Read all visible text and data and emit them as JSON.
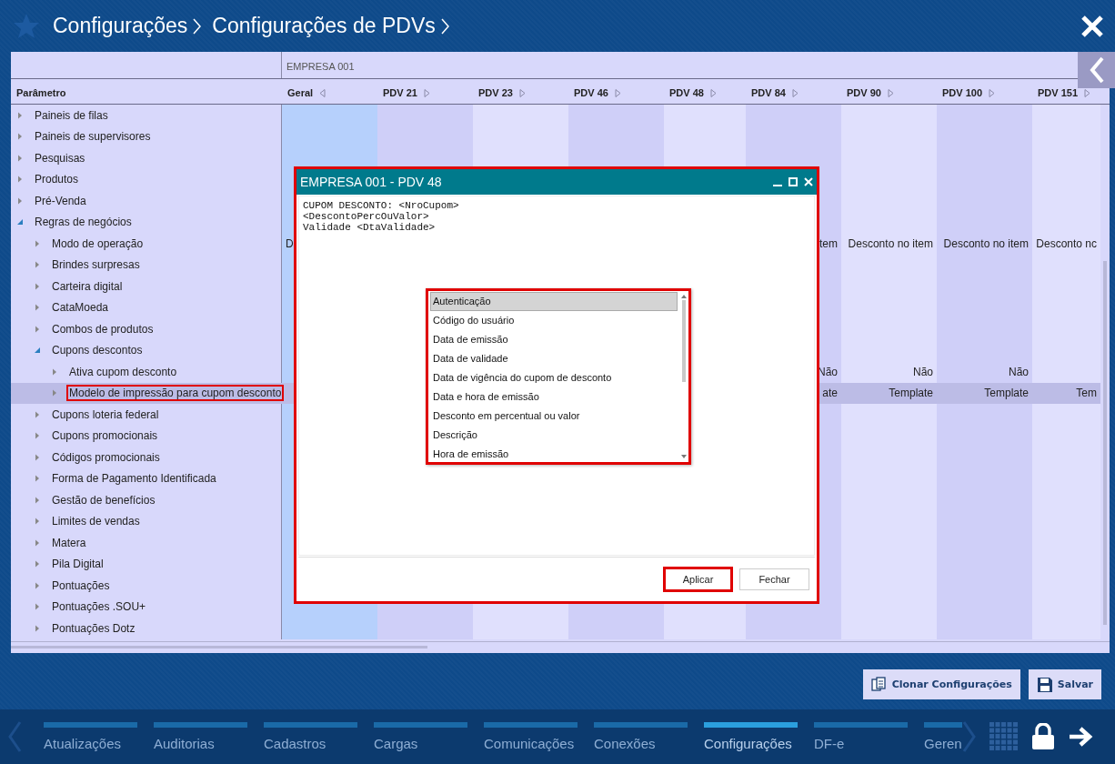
{
  "header": {
    "breadcrumb": [
      "Configurações",
      "Configurações de PDVs"
    ]
  },
  "grid": {
    "group_label": "EMPRESA 001",
    "parameter_header": "Parâmetro",
    "columns": [
      {
        "label": "Geral",
        "expanded": true,
        "selected": true
      },
      {
        "label": "PDV 21",
        "expanded": false,
        "selected": false
      },
      {
        "label": "PDV 23",
        "expanded": false,
        "selected": false
      },
      {
        "label": "PDV 46",
        "expanded": false,
        "selected": false
      },
      {
        "label": "PDV 48",
        "expanded": false,
        "selected": false
      },
      {
        "label": "PDV 84",
        "expanded": false,
        "selected": false
      },
      {
        "label": "PDV 90",
        "expanded": false,
        "selected": false
      },
      {
        "label": "PDV 100",
        "expanded": false,
        "selected": false
      },
      {
        "label": "PDV 151",
        "expanded": false,
        "selected": false
      }
    ],
    "tree": [
      {
        "label": "Paineis de filas",
        "expanded": false,
        "selected": false
      },
      {
        "label": "Paineis de supervisores",
        "expanded": false,
        "selected": false
      },
      {
        "label": "Pesquisas",
        "expanded": false,
        "selected": false
      },
      {
        "label": "Produtos",
        "expanded": false,
        "selected": false
      },
      {
        "label": "Pré-Venda",
        "expanded": false,
        "selected": false
      },
      {
        "label": "Regras de negócios",
        "expanded": true,
        "selected": false,
        "children": [
          {
            "label": "Modo de operação",
            "expanded": false,
            "selected": false,
            "cells": [
              "D",
              null,
              null,
              null,
              null,
              "tem",
              "Desconto no item",
              "Desconto no item",
              "Desconto nc"
            ]
          },
          {
            "label": "Brindes surpresas",
            "expanded": false,
            "selected": false
          },
          {
            "label": "Carteira digital",
            "expanded": false,
            "selected": false
          },
          {
            "label": "CataMoeda",
            "expanded": false,
            "selected": false
          },
          {
            "label": "Combos de produtos",
            "expanded": false,
            "selected": false
          },
          {
            "label": "Cupons descontos",
            "expanded": true,
            "selected": false,
            "children": [
              {
                "label": "Ativa cupom desconto",
                "expanded": false,
                "selected": false,
                "cells": [
                  null,
                  null,
                  null,
                  null,
                  null,
                  "Não",
                  "Não",
                  "Não",
                  null
                ]
              },
              {
                "label": "Modelo de impressão para cupom desconto",
                "expanded": false,
                "selected": true,
                "annotated": true,
                "cells": [
                  null,
                  null,
                  null,
                  null,
                  null,
                  "ate",
                  "Template",
                  "Template",
                  "Tem"
                ]
              }
            ]
          },
          {
            "label": "Cupons loteria federal",
            "expanded": false,
            "selected": false
          },
          {
            "label": "Cupons promocionais",
            "expanded": false,
            "selected": false
          },
          {
            "label": "Códigos promocionais",
            "expanded": false,
            "selected": false
          },
          {
            "label": "Forma de Pagamento Identificada",
            "expanded": false,
            "selected": false
          },
          {
            "label": "Gestão de benefícios",
            "expanded": false,
            "selected": false
          },
          {
            "label": "Limites de vendas",
            "expanded": false,
            "selected": false
          },
          {
            "label": "Matera",
            "expanded": false,
            "selected": false
          },
          {
            "label": "Pila Digital",
            "expanded": false,
            "selected": false
          },
          {
            "label": "Pontuações",
            "expanded": false,
            "selected": false
          },
          {
            "label": "Pontuações .SOU+",
            "expanded": false,
            "selected": false
          },
          {
            "label": "Pontuações Dotz",
            "expanded": false,
            "selected": false
          }
        ]
      }
    ]
  },
  "dialog": {
    "title": "EMPRESA 001 - PDV 48",
    "annotated": true,
    "value": "CUPOM DESCONTO: <NroCupom>\n<DescontoPercOuValor>\nValidade <DtaValidade>",
    "field_list": {
      "annotated": true,
      "items": [
        {
          "label": "Autenticação",
          "selected": true
        },
        {
          "label": "Código do usuário",
          "selected": false
        },
        {
          "label": "Data de emissão",
          "selected": false
        },
        {
          "label": "Data de validade",
          "selected": false
        },
        {
          "label": "Data de vigência do cupom de desconto",
          "selected": false
        },
        {
          "label": "Data e hora de emissão",
          "selected": false
        },
        {
          "label": "Desconto em percentual ou valor",
          "selected": false
        },
        {
          "label": "Descrição",
          "selected": false
        },
        {
          "label": "Hora de emissão",
          "selected": false
        }
      ]
    },
    "buttons": [
      {
        "label": "Aplicar",
        "annotated": true
      },
      {
        "label": "Fechar",
        "annotated": false
      }
    ]
  },
  "actions": [
    {
      "label": "Clonar Configurações",
      "kind": "clone"
    },
    {
      "label": "Salvar",
      "kind": "save"
    }
  ],
  "nav": [
    {
      "label": "Atualizações",
      "selected": false
    },
    {
      "label": "Auditorias",
      "selected": false
    },
    {
      "label": "Cadastros",
      "selected": false
    },
    {
      "label": "Cargas",
      "selected": false
    },
    {
      "label": "Comunicações",
      "selected": false
    },
    {
      "label": "Conexões",
      "selected": false
    },
    {
      "label": "Configurações",
      "selected": true
    },
    {
      "label": "DF-e",
      "selected": false
    },
    {
      "label": "Geren",
      "selected": false
    }
  ]
}
